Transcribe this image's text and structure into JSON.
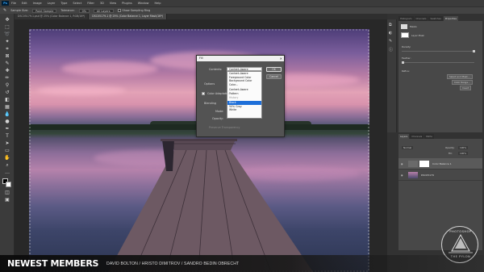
{
  "app": {
    "logo": "Ps"
  },
  "menubar": [
    "File",
    "Edit",
    "Image",
    "Layer",
    "Type",
    "Select",
    "Filter",
    "3D",
    "View",
    "Plugins",
    "Window",
    "Help"
  ],
  "options_bar": {
    "sample_size_label": "Sample Size:",
    "sample_size_value": "Point Sample",
    "tolerance_label": "Tolerance:",
    "tolerance_value": "0%",
    "sample_layers": "All Layers",
    "show_sampling_ring": "Show Sampling Ring"
  },
  "doc_tabs": [
    {
      "label": "DSC05179-1.psd @ 25% (Color Balance 1, RGB/16*)",
      "active": false
    },
    {
      "label": "DSC05179-1 @ 25% (Color Balance 1, Layer Mask/16*)",
      "active": true
    }
  ],
  "fill_dialog": {
    "title": "Fill",
    "close": "✕",
    "contents_label": "Contents:",
    "contents_value": "Content-Aware",
    "options_label": "Options",
    "color_adaptation_label": "Color Adaptation",
    "blending_label": "Blending",
    "mode_label": "Mode:",
    "opacity_label": "Opacity:",
    "preserve_label": "Preserve Transparency",
    "ok_label": "OK",
    "cancel_label": "Cancel",
    "options": [
      {
        "label": "Content-Aware",
        "state": "normal"
      },
      {
        "label": "Foreground Color",
        "state": "normal"
      },
      {
        "label": "Background Color",
        "state": "normal"
      },
      {
        "label": "Color...",
        "state": "normal"
      },
      {
        "label": "",
        "state": "sep"
      },
      {
        "label": "Content-Aware",
        "state": "normal"
      },
      {
        "label": "Pattern",
        "state": "normal"
      },
      {
        "label": "History",
        "state": "disabled"
      },
      {
        "label": "",
        "state": "sep"
      },
      {
        "label": "Black",
        "state": "selected"
      },
      {
        "label": "50% Gray",
        "state": "normal"
      },
      {
        "label": "White",
        "state": "normal"
      }
    ]
  },
  "right_panel": {
    "top_tabs": [
      "Histogram",
      "Channels",
      "Swatches",
      "Properties"
    ],
    "active_top_tab": "Properties",
    "masks_label": "Masks",
    "layer_mask_label": "Layer Mask",
    "density_label": "Density:",
    "feather_label": "Feather:",
    "refine_label": "Refine:",
    "select_mask_btn": "Select and Mask...",
    "color_range_btn": "Color Range...",
    "invert_btn": "Invert",
    "layers_tabs": [
      "Layers",
      "Channels",
      "Paths"
    ],
    "blend_mode": "Normal",
    "opacity_label": "Opacity:",
    "opacity_value": "100%",
    "fill_label": "Fill:",
    "fill_value": "100%",
    "layers": [
      {
        "name": "Color Balance 1",
        "active": true
      },
      {
        "name": "DSC05179",
        "active": false
      }
    ]
  },
  "watermark": {
    "line1": "PHOTOSHOP",
    "line2": "THE PYLON"
  },
  "banner": {
    "title": "NEWEST MEMBERS",
    "names": "DAVID BOLTON   /   HRISTO DIMITROV   /   SANDRO BEDIN OBRECHT"
  },
  "colors": {
    "accent": "#1e6fd9",
    "panel": "#484848",
    "chrome": "#3b3b3b"
  }
}
